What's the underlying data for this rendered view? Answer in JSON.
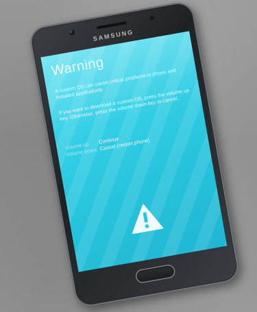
{
  "device": {
    "brand": "SAMSUNG"
  },
  "screen": {
    "title": "Warning",
    "paragraphs": [
      "A custom OS can cause critical problems in phone and installed applications.",
      "If you want to download a custom OS, press the volume up key. Otherwise, press the volume down key to cancel."
    ],
    "options": [
      {
        "key": "Volume up:",
        "action": "Continue"
      },
      {
        "key": "Volume down:",
        "action": "Cancel (restart phone)"
      }
    ],
    "icon": "warning-triangle-icon",
    "colors": {
      "background": "#33cfe6",
      "text": "#ffffff"
    }
  }
}
